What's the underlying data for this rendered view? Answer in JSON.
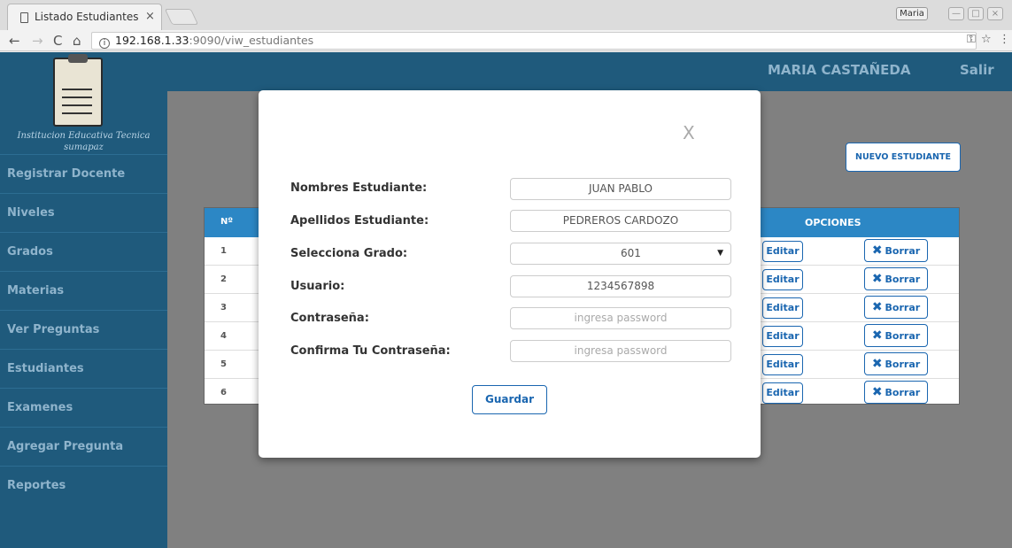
{
  "browser": {
    "tab_title": "Listado Estudiantes",
    "tab_close": "×",
    "user_badge": "Maria",
    "url_host": "192.168.1.33",
    "url_path": ":9090/viw_estudiantes"
  },
  "sidebar": {
    "logo_text": "Institucion Educativa Tecnica sumapaz",
    "items": [
      {
        "label": "Registrar Docente"
      },
      {
        "label": "Niveles"
      },
      {
        "label": "Grados"
      },
      {
        "label": "Materias"
      },
      {
        "label": "Ver Preguntas"
      },
      {
        "label": "Estudiantes"
      },
      {
        "label": "Examenes"
      },
      {
        "label": "Agregar Pregunta"
      },
      {
        "label": "Reportes"
      }
    ]
  },
  "header": {
    "user_name": "MARIA CASTAÑEDA",
    "logout": "Salir"
  },
  "main": {
    "new_student_button": "NUEVO ESTUDIANTE",
    "table": {
      "col_num": "Nº",
      "col_options": "OPCIONES",
      "rows": [
        "1",
        "2",
        "3",
        "4",
        "5",
        "6"
      ],
      "edit_label": "Editar",
      "delete_label": "Borrar"
    }
  },
  "modal": {
    "close": "X",
    "fields": [
      {
        "label": "Nombres Estudiante:",
        "value": "JUAN PABLO"
      },
      {
        "label": "Apellidos Estudiante:",
        "value": "PEDREROS CARDOZO"
      },
      {
        "label": "Selecciona Grado:",
        "value": "601"
      },
      {
        "label": "Usuario:",
        "value": "1234567898"
      },
      {
        "label": "Contraseña:",
        "placeholder": "ingresa password"
      },
      {
        "label": "Confirma Tu Contraseña:",
        "placeholder": "ingresa password"
      }
    ],
    "save_button": "Guardar"
  },
  "colors": {
    "sidebar": "#1f5a7c",
    "table_header": "#2c87c5",
    "button_accent": "#1a66b0"
  }
}
